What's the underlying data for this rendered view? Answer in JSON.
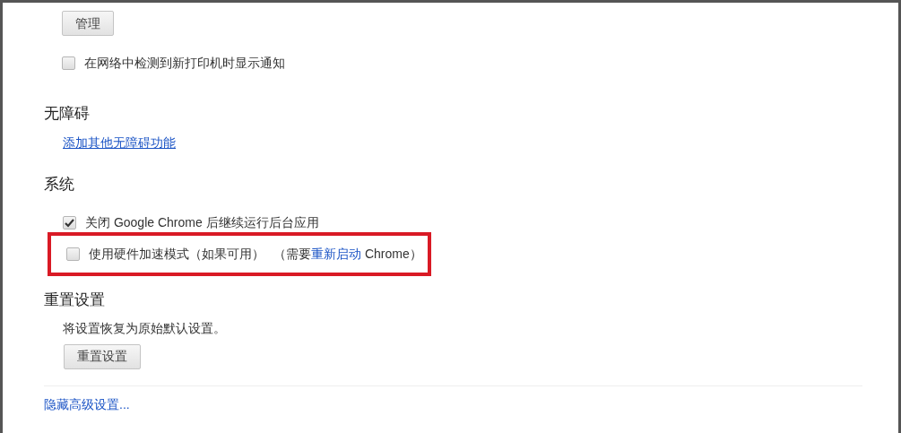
{
  "printers": {
    "button": "管理",
    "option": {
      "label": "在网络中检测到新打印机时显示通知",
      "checked": false
    }
  },
  "accessibility": {
    "title": "无障碍",
    "link": "添加其他无障碍功能"
  },
  "system": {
    "title": "系统",
    "options": [
      {
        "label": "关闭 Google Chrome 后继续运行后台应用",
        "checked": true,
        "highlighted": false
      },
      {
        "label": "使用硬件加速模式（如果可用）",
        "note_prefix": "（需要",
        "note_link": "重新启动",
        "note_suffix": " Chrome）",
        "checked": false,
        "highlighted": true
      }
    ]
  },
  "reset": {
    "title": "重置设置",
    "description": "将设置恢复为原始默认设置。",
    "button": "重置设置"
  },
  "footer_link": "隐藏高级设置..."
}
